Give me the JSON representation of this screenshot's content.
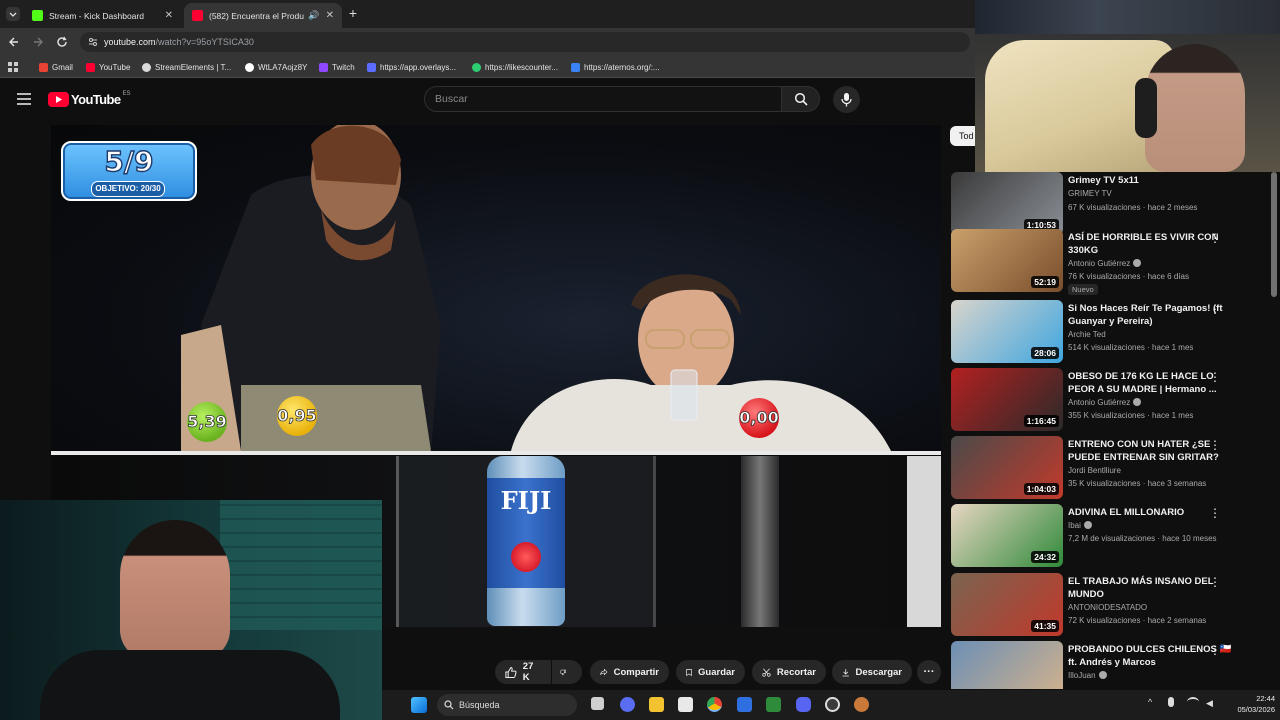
{
  "browser": {
    "tabs": [
      {
        "title": "Stream - Kick Dashboard",
        "active": false,
        "favicon_color": "#53fc18"
      },
      {
        "title": "(582) Encuentra el Producto",
        "active": true,
        "favicon_color": "#ff0033"
      }
    ],
    "new_tab_label": "+",
    "url_host": "youtube.com",
    "url_path": "/watch?v=95oYTSICA30",
    "bookmarks": [
      {
        "label": "Gmail",
        "color": "#ea4335"
      },
      {
        "label": "YouTube",
        "color": "#ff0033"
      },
      {
        "label": "StreamElements | T...",
        "color": "#d9d9d9"
      },
      {
        "label": "WtLA7Aojz8Y",
        "color": "#ffffff"
      },
      {
        "label": "Twitch",
        "color": "#9146ff"
      },
      {
        "label": "https://app.overlays...",
        "color": "#5b6cff"
      },
      {
        "label": "https://likescounter...",
        "color": "#2ecc71"
      },
      {
        "label": "https://aternos.org/:...",
        "color": "#3b82f6"
      }
    ]
  },
  "youtube": {
    "logo_text": "YouTube",
    "region": "ES",
    "search_placeholder": "Buscar"
  },
  "video": {
    "counter_main": "5/9",
    "counter_sub": "OBJETIVO: 20/30",
    "price_balls": [
      {
        "label": "5,39",
        "color": "#7ec832"
      },
      {
        "label": "0,95",
        "color": "#f2c414"
      },
      {
        "label": "0,00",
        "color": "#e8262c"
      }
    ],
    "bottle_label": "FIJI"
  },
  "actions": {
    "likes": "27 K",
    "share": "Compartir",
    "save": "Guardar",
    "clip": "Recortar",
    "download": "Descargar",
    "more": "···"
  },
  "sidebar": {
    "chip_label": "Tod",
    "recommendations": [
      {
        "title": "Grimey TV 5x11",
        "channel": "GRIMEY TV",
        "meta": "67 K visualizaciones · hace 2 meses",
        "duration": "1:10:53",
        "verified": false,
        "badge": "",
        "colors": [
          "#3a3a3a",
          "#8a8f96"
        ]
      },
      {
        "title": "ASÍ DE HORRIBLE ES VIVIR CON 330KG",
        "channel": "Antonio Gutiérrez",
        "meta": "76 K visualizaciones · hace 6 días",
        "duration": "52:19",
        "verified": true,
        "badge": "Nuevo",
        "colors": [
          "#c9a06b",
          "#7a4e2c"
        ]
      },
      {
        "title": "Si Nos Haces Reír Te Pagamos! (ft Guanyar y Pereira)",
        "channel": "Archie Ted",
        "meta": "514 K visualizaciones · hace 1 mes",
        "duration": "28:06",
        "verified": false,
        "badge": "",
        "colors": [
          "#d8d4cc",
          "#3fa6e0"
        ]
      },
      {
        "title": "OBESO DE 176 KG LE HACE LO PEOR A SU MADRE | Hermano ...",
        "channel": "Antonio Gutiérrez",
        "meta": "355 K visualizaciones · hace 1 mes",
        "duration": "1:16:45",
        "verified": true,
        "badge": "",
        "colors": [
          "#b32020",
          "#2a2a2a"
        ]
      },
      {
        "title": "ENTRENO CON UN HATER ¿SE PUEDE ENTRENAR SIN GRITAR?",
        "channel": "Jordi Bentlliure",
        "meta": "35 K visualizaciones · hace 3 semanas",
        "duration": "1:04:03",
        "verified": false,
        "badge": "",
        "colors": [
          "#4a4a4a",
          "#c23a2b"
        ]
      },
      {
        "title": "ADIVINA EL MILLONARIO",
        "channel": "Ibai",
        "meta": "7,2 M de visualizaciones · hace 10 meses",
        "duration": "24:32",
        "verified": true,
        "badge": "",
        "colors": [
          "#e7d6c2",
          "#2f8a3a"
        ]
      },
      {
        "title": "EL TRABAJO MÁS INSANO DEL MUNDO",
        "channel": "ANTONIODESATADO",
        "meta": "72 K visualizaciones · hace 2 semanas",
        "duration": "41:35",
        "verified": false,
        "badge": "",
        "colors": [
          "#7a6450",
          "#c0392b"
        ]
      },
      {
        "title": "PROBANDO DULCES CHILENOS 🇨🇱 ft. Andrés y Marcos",
        "channel": "IlloJuan",
        "meta": "",
        "duration": "",
        "verified": true,
        "badge": "",
        "colors": [
          "#6c8fb5",
          "#d6b38a"
        ]
      }
    ]
  },
  "taskbar": {
    "search_label": "Búsqueda",
    "time": "22:44",
    "date": "05/03/2026"
  }
}
